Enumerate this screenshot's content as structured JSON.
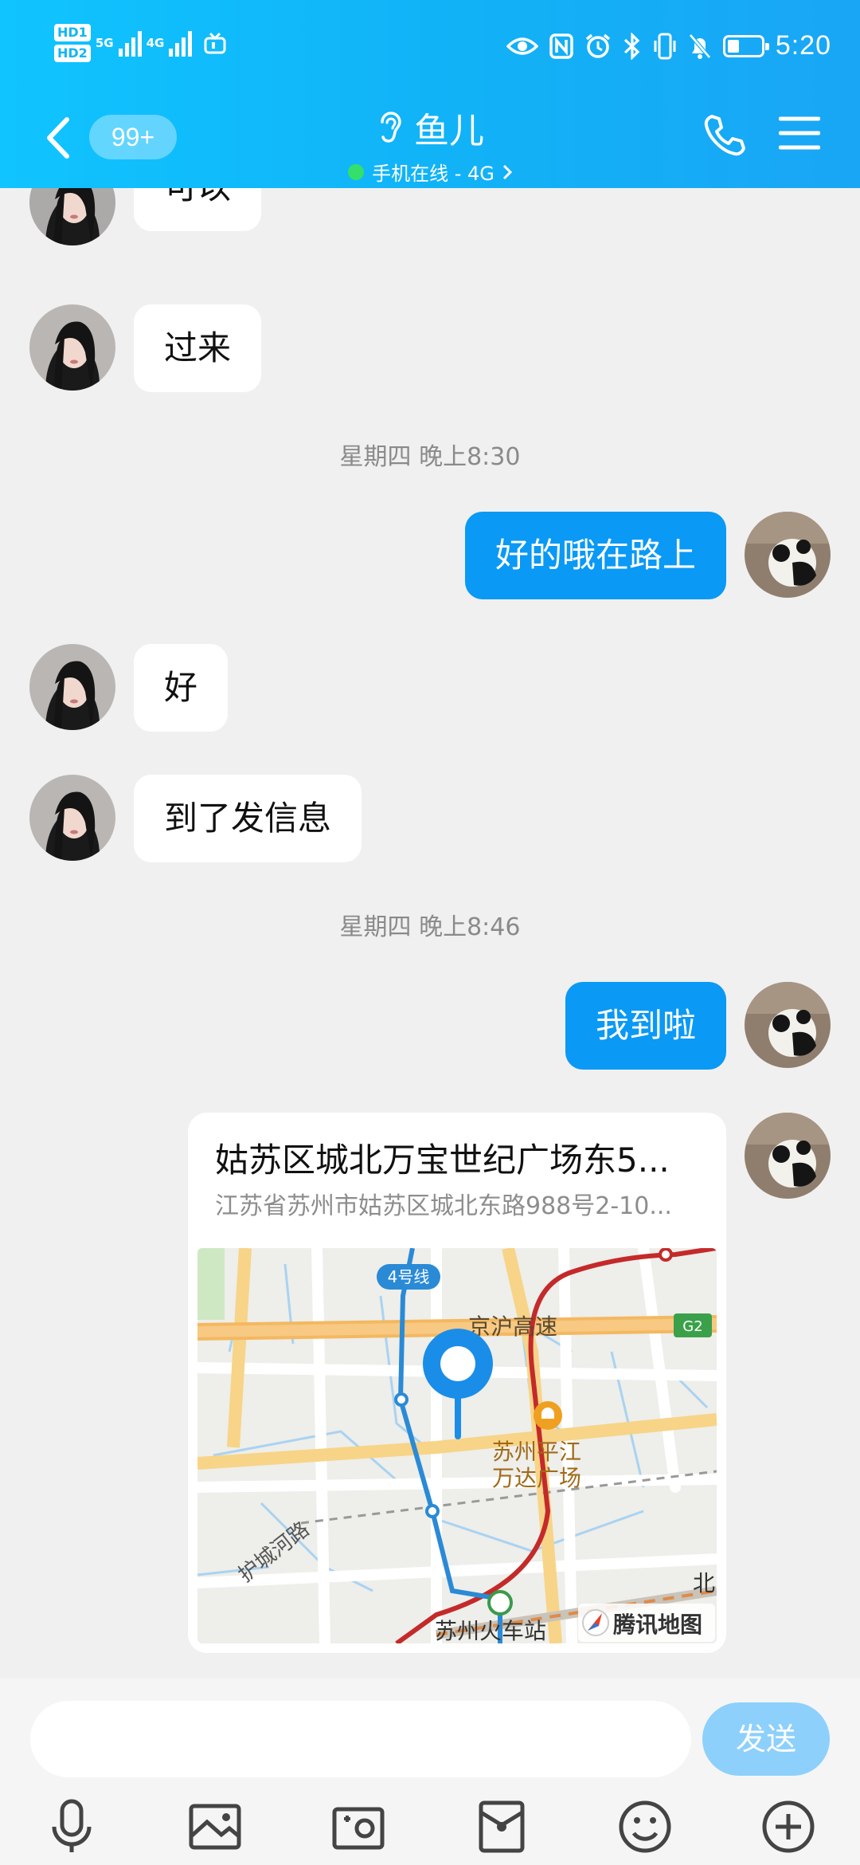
{
  "status_bar": {
    "hd1": "HD1",
    "hd2": "HD2",
    "net1": "5G",
    "net2": "4G",
    "time": "5:20",
    "battery_level": 0.35
  },
  "header": {
    "unread_badge": "99+",
    "contact_name": "鱼儿",
    "online_status": "手机在线 - 4G",
    "online_color": "#34e06a"
  },
  "messages": {
    "m1": "可以",
    "m2": "过来",
    "ts1": "星期四 晚上8:30",
    "m3": "好的哦在路上",
    "m4": "好",
    "m5": "到了发信息",
    "ts2": "星期四 晚上8:46",
    "m6": "我到啦"
  },
  "location_card": {
    "title": "姑苏区城北万宝世纪广场东5...",
    "address": "江苏省苏州市姑苏区城北东路988号2-10...",
    "map_labels": {
      "metro_line": "4号线",
      "highway": "京沪高速",
      "highway_code": "G2",
      "plaza_line1": "苏州平江",
      "plaza_line2": "万达广场",
      "road": "护城河路",
      "station": "苏州火车站",
      "north": "北",
      "map_brand": "腾讯地图"
    }
  },
  "input_bar": {
    "placeholder": "",
    "send_label": "发送"
  },
  "colors": {
    "header_accent": "#11b3f7",
    "outgoing_bubble": "#0a99f5",
    "send_button": "#8dd0fb"
  }
}
